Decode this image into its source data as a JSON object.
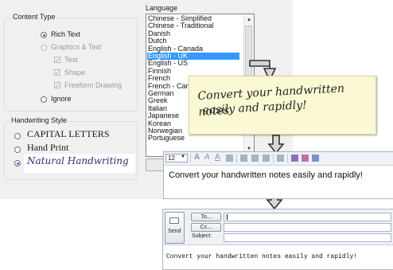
{
  "content_type": {
    "title": "Content Type",
    "rich_text": "Rich Text",
    "graphics_text": "Graphics & Text",
    "text": "Text",
    "shape": "Shape",
    "freeform": "Freeform Drawing",
    "ignore": "Ignore"
  },
  "handwriting_style": {
    "title": "Handwriting Style",
    "capital": "CAPITAL LETTERS",
    "hand_print": "Hand Print",
    "natural": "Natural Handwriting"
  },
  "language": {
    "title": "Language",
    "items": [
      "Chinese - Simplified",
      "Chinese - Traditional",
      "Danish",
      "Dutch",
      "English - Canada",
      "English - UK",
      "English - US",
      "Finnish",
      "French",
      "French - Canada",
      "German",
      "Greek",
      "Italian",
      "Japanese",
      "Korean",
      "Norwegian",
      "Portuguese"
    ],
    "selected": "English - UK"
  },
  "note": {
    "line1": "Convert your handwritten notes",
    "line2": "easily and rapidly!"
  },
  "editor": {
    "font_size": "12",
    "text": "Convert your handwritten notes easily and rapidly!"
  },
  "email": {
    "send": "Send",
    "to": "To...",
    "cc": "Cc...",
    "subject": "Subject:",
    "body": "Convert your handwritten notes easily and rapidly!"
  },
  "colors": {
    "selection": "#3399ff",
    "note_bg": "#fbf9d4"
  }
}
